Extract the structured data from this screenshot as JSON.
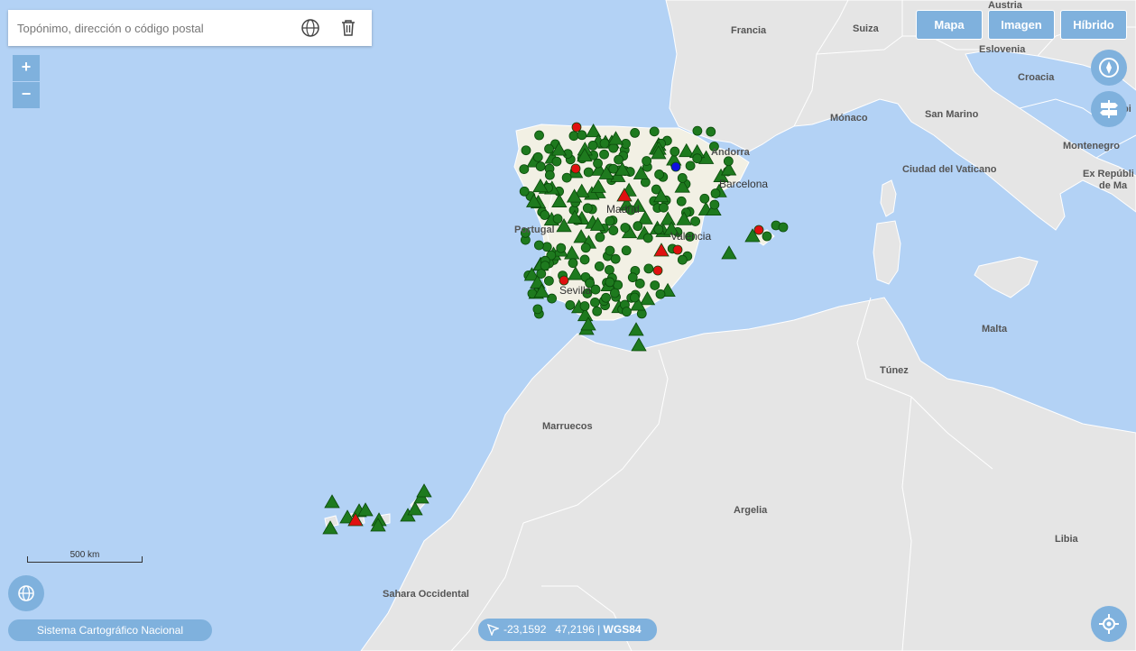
{
  "search": {
    "placeholder": "Topónimo, dirección o código postal"
  },
  "zoom": {
    "in_label": "+",
    "out_label": "−"
  },
  "map_types": [
    {
      "label": "Mapa"
    },
    {
      "label": "Imagen"
    },
    {
      "label": "Híbrido"
    }
  ],
  "map_labels": {
    "austria": "Austria",
    "francia": "Francia",
    "suiza": "Suiza",
    "eslovenia": "Eslovenia",
    "croacia": "Croacia",
    "monaco": "Mónaco",
    "san_marino": "San Marino",
    "montenegro": "Montenegro",
    "vaticano": "Ciudad del Vaticano",
    "rep_line1": "Ex Repúbli",
    "rep_line2": "de Ma",
    "andorra": "Andorra",
    "barcelona": "Barcelona",
    "madrid": "Madrid",
    "valencia": "Valencia",
    "sevilla": "Sevilla",
    "portugal": "Portugal",
    "malta": "Malta",
    "tunez": "Túnez",
    "marruecos": "Marruecos",
    "argelia": "Argelia",
    "libia": "Libia",
    "sahara": "Sahara Occidental",
    "edge_bi": "bi"
  },
  "scale_label": "500 km",
  "footer": {
    "sistema": "Sistema Cartográfico Nacional",
    "coords": "-23,1592   47,2196 |",
    "crs": "WGS84"
  },
  "colors": {
    "sea": "#b3d2f5",
    "land": "#e5e5e5",
    "spain_land": "#f2f0e4",
    "marker_green": "#1e7a1e",
    "marker_red": "#e01010",
    "marker_blue": "#1010e0",
    "button": "#7fb1dd"
  },
  "icons": {
    "search_buttons": [
      "globe-icon",
      "trash-icon"
    ],
    "right_buttons": [
      "compass-icon",
      "signpost-icon"
    ],
    "globe_button": "globe-icon",
    "locate_button": "locate-icon",
    "coords": "cursor-icon"
  }
}
